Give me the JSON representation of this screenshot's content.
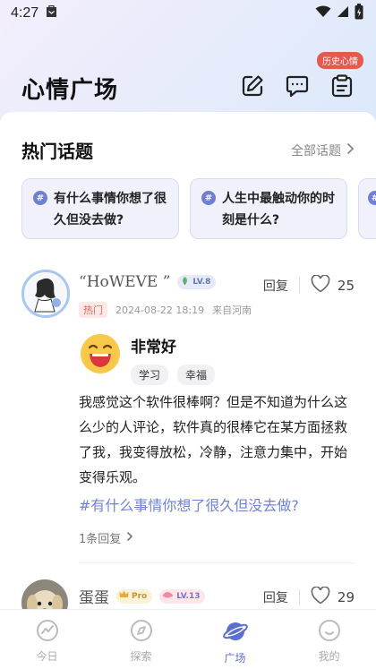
{
  "status_bar": {
    "time": "4:27"
  },
  "header": {
    "title": "心情广场",
    "history_badge": "历史心情"
  },
  "hot_topics": {
    "title": "热门话题",
    "see_all": "全部话题",
    "items": [
      {
        "text": "有什么事情你想了很久但没去做?"
      },
      {
        "text": "人生中最触动你的时刻是什么?"
      },
      {
        "text": ""
      }
    ]
  },
  "posts": [
    {
      "username": "“HoWEVE ”",
      "level": "LV.8",
      "hot_tag": "热门",
      "date": "2024-08-22 18:19",
      "location": "来自河南",
      "reply_label": "回复",
      "likes": "25",
      "mood": {
        "name": "非常好",
        "tags": [
          "学习",
          "幸福"
        ]
      },
      "body": "我感觉这个软件很棒啊？但是不知道为什么这么少的人评论，软件真的很棒它在某方面拯救了我，我变得放松，冷静，注意力集中，开始变得乐观。",
      "topic": "#有什么事情你想了很久但没去做?",
      "reply_count": "1条回复"
    },
    {
      "username": "蛋蛋",
      "pro": "Pro",
      "level": "LV.13",
      "reply_label": "回复",
      "likes": "29"
    }
  ],
  "bottom_nav": {
    "items": [
      {
        "label": "今日",
        "icon": "today-icon"
      },
      {
        "label": "探索",
        "icon": "compass-icon"
      },
      {
        "label": "广场",
        "icon": "planet-icon"
      },
      {
        "label": "我的",
        "icon": "profile-icon"
      }
    ],
    "active_index": 2
  },
  "colors": {
    "accent": "#5a6fd0",
    "topic_link": "#6f83d4",
    "badge_red": "#e55a4e",
    "mood_yellow": "#f7c84a"
  }
}
